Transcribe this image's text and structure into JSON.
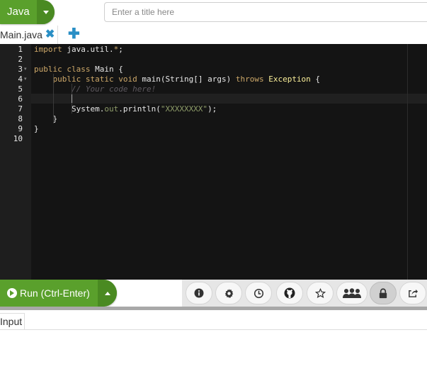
{
  "header": {
    "language_label": "Java",
    "title_placeholder": "Enter a title here",
    "title_value": ""
  },
  "tabs": {
    "file_name": "Main.java",
    "close_glyph": "✖",
    "add_glyph": "✚"
  },
  "editor": {
    "line_numbers": [
      "1",
      "2",
      "3",
      "4",
      "5",
      "6",
      "7",
      "8",
      "9",
      "10"
    ],
    "lines": [
      {
        "tokens": [
          {
            "t": "import",
            "c": "kw"
          },
          {
            "t": " java.util.",
            "c": "cl"
          },
          {
            "t": "*",
            "c": "kw"
          },
          {
            "t": ";",
            "c": "cl"
          }
        ]
      },
      {
        "tokens": []
      },
      {
        "tokens": [
          {
            "t": "public",
            "c": "kw"
          },
          {
            "t": " ",
            "c": "cl"
          },
          {
            "t": "class",
            "c": "kw"
          },
          {
            "t": " Main {",
            "c": "cl"
          }
        ]
      },
      {
        "tokens": [
          {
            "t": "    ",
            "c": "cl"
          },
          {
            "t": "public",
            "c": "kw"
          },
          {
            "t": " ",
            "c": "cl"
          },
          {
            "t": "static",
            "c": "kw"
          },
          {
            "t": " ",
            "c": "cl"
          },
          {
            "t": "void",
            "c": "kw"
          },
          {
            "t": " main(String[] args) ",
            "c": "cl"
          },
          {
            "t": "throws",
            "c": "kw"
          },
          {
            "t": " ",
            "c": "cl"
          },
          {
            "t": "Exception",
            "c": "ex"
          },
          {
            "t": " {",
            "c": "cl"
          }
        ]
      },
      {
        "tokens": [
          {
            "t": "        ",
            "c": "cl"
          },
          {
            "t": "// Your code here!",
            "c": "cm"
          }
        ]
      },
      {
        "tokens": []
      },
      {
        "tokens": [
          {
            "t": "        System.",
            "c": "cl"
          },
          {
            "t": "out",
            "c": "st"
          },
          {
            "t": ".println(",
            "c": "cl"
          },
          {
            "t": "\"XXXXXXXX\"",
            "c": "st"
          },
          {
            "t": ");",
            "c": "cl"
          }
        ]
      },
      {
        "tokens": [
          {
            "t": "    }",
            "c": "cl"
          }
        ]
      },
      {
        "tokens": [
          {
            "t": "}",
            "c": "cl"
          }
        ]
      },
      {
        "tokens": []
      }
    ],
    "fold_markers": {
      "3": "▾",
      "4": "▾"
    }
  },
  "toolbar": {
    "run_label": "Run (Ctrl-Enter)",
    "buttons": [
      {
        "name": "info-icon",
        "glyph": "i"
      },
      {
        "name": "gear-icon",
        "glyph": "⚙"
      },
      {
        "name": "history-icon",
        "glyph": "◷"
      },
      {
        "name": "github-icon",
        "glyph": "●"
      },
      {
        "name": "star-icon",
        "glyph": "☆"
      },
      {
        "name": "collaborate-icon",
        "glyph": "●●●"
      },
      {
        "name": "lock-icon",
        "glyph": "■"
      },
      {
        "name": "share-icon",
        "glyph": "↗"
      }
    ]
  },
  "input": {
    "tab_label": "Input"
  },
  "colors": {
    "accent_green": "#5aa02c",
    "accent_blue": "#2a8fc5",
    "editor_bg": "#141414",
    "keyword": "#cda869",
    "string": "#8f9d6a",
    "comment": "#5f5a60"
  }
}
